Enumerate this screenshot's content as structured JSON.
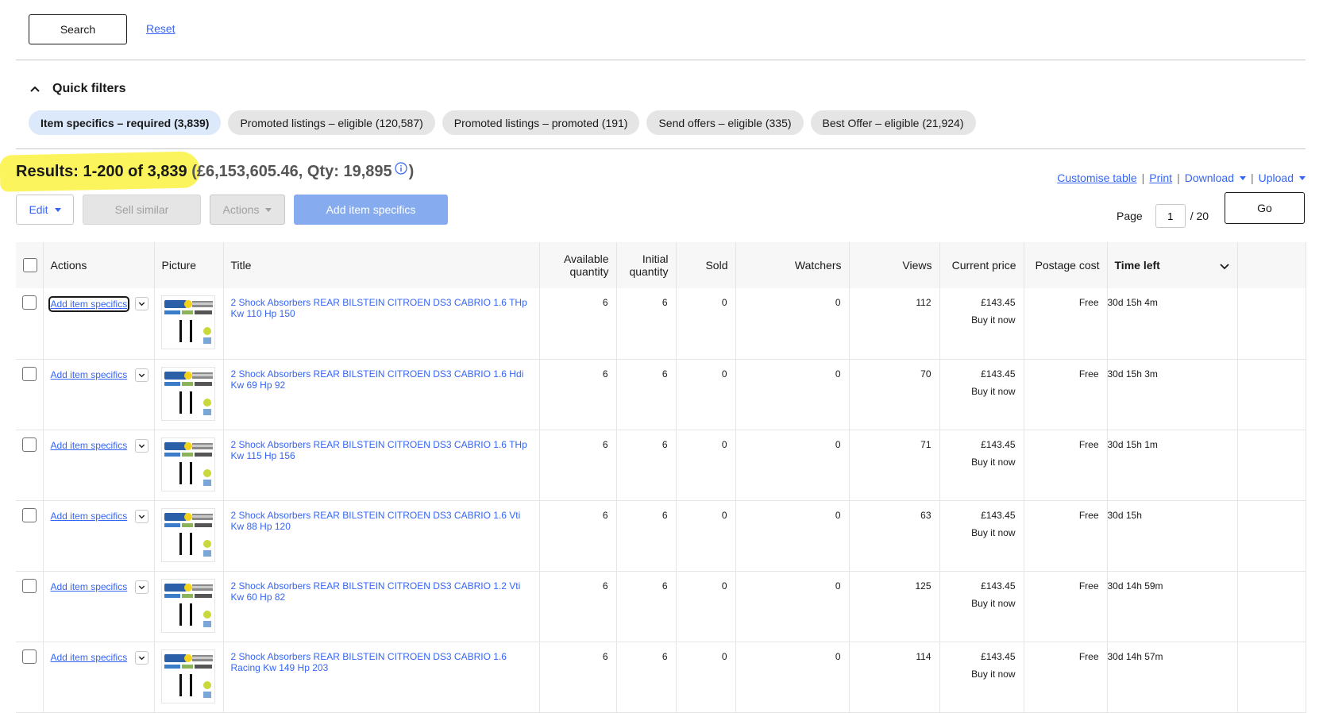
{
  "search": {
    "button": "Search",
    "reset": "Reset"
  },
  "quick_filters": {
    "title": "Quick filters",
    "chips": [
      "Item specifics – required (3,839)",
      "Promoted listings – eligible (120,587)",
      "Promoted listings – promoted (191)",
      "Send offers – eligible (335)",
      "Best Offer – eligible (21,924)"
    ],
    "selected_index": 0
  },
  "results": {
    "label": "Results: 1-200 of 3,839",
    "totals": "(£6,153,605.46, Qty: 19,895",
    "close": ")",
    "highlight_color": "#fbf34a"
  },
  "top_links": {
    "customise": "Customise table",
    "print": "Print",
    "download": "Download",
    "upload": "Upload",
    "sep": "|"
  },
  "toolbar": {
    "edit": "Edit",
    "sell_similar": "Sell similar",
    "actions": "Actions",
    "add_item_specifics": "Add item specifics"
  },
  "pager": {
    "label": "Page",
    "current": "1",
    "total": "/ 20",
    "go": "Go"
  },
  "table": {
    "headers": {
      "actions": "Actions",
      "picture": "Picture",
      "title": "Title",
      "available": "Available quantity",
      "initial": "Initial quantity",
      "sold": "Sold",
      "watchers": "Watchers",
      "views": "Views",
      "price": "Current price",
      "postage": "Postage cost",
      "time": "Time left"
    },
    "action_label": "Add item specifics",
    "rows": [
      {
        "title": "2 Shock Absorbers REAR BILSTEIN CITROEN DS3 CABRIO 1.6 THp Kw 110 Hp 150",
        "available": "6",
        "initial": "6",
        "sold": "0",
        "watchers": "0",
        "views": "112",
        "price": "£143.45",
        "format": "Buy it now",
        "postage": "Free",
        "time": "30d 15h 4m"
      },
      {
        "title": "2 Shock Absorbers REAR BILSTEIN CITROEN DS3 CABRIO 1.6 Hdi Kw 69 Hp 92",
        "available": "6",
        "initial": "6",
        "sold": "0",
        "watchers": "0",
        "views": "70",
        "price": "£143.45",
        "format": "Buy it now",
        "postage": "Free",
        "time": "30d 15h 3m"
      },
      {
        "title": "2 Shock Absorbers REAR BILSTEIN CITROEN DS3 CABRIO 1.6 THp Kw 115 Hp 156",
        "available": "6",
        "initial": "6",
        "sold": "0",
        "watchers": "0",
        "views": "71",
        "price": "£143.45",
        "format": "Buy it now",
        "postage": "Free",
        "time": "30d 15h 1m"
      },
      {
        "title": "2 Shock Absorbers REAR BILSTEIN CITROEN DS3 CABRIO 1.6 Vti Kw 88 Hp 120",
        "available": "6",
        "initial": "6",
        "sold": "0",
        "watchers": "0",
        "views": "63",
        "price": "£143.45",
        "format": "Buy it now",
        "postage": "Free",
        "time": "30d 15h"
      },
      {
        "title": "2 Shock Absorbers REAR BILSTEIN CITROEN DS3 CABRIO 1.2 Vti Kw 60 Hp 82",
        "available": "6",
        "initial": "6",
        "sold": "0",
        "watchers": "0",
        "views": "125",
        "price": "£143.45",
        "format": "Buy it now",
        "postage": "Free",
        "time": "30d 14h 59m"
      },
      {
        "title": "2 Shock Absorbers REAR BILSTEIN CITROEN DS3 CABRIO 1.6 Racing Kw 149 Hp 203",
        "available": "6",
        "initial": "6",
        "sold": "0",
        "watchers": "0",
        "views": "114",
        "price": "£143.45",
        "format": "Buy it now",
        "postage": "Free",
        "time": "30d 14h 57m"
      }
    ]
  }
}
